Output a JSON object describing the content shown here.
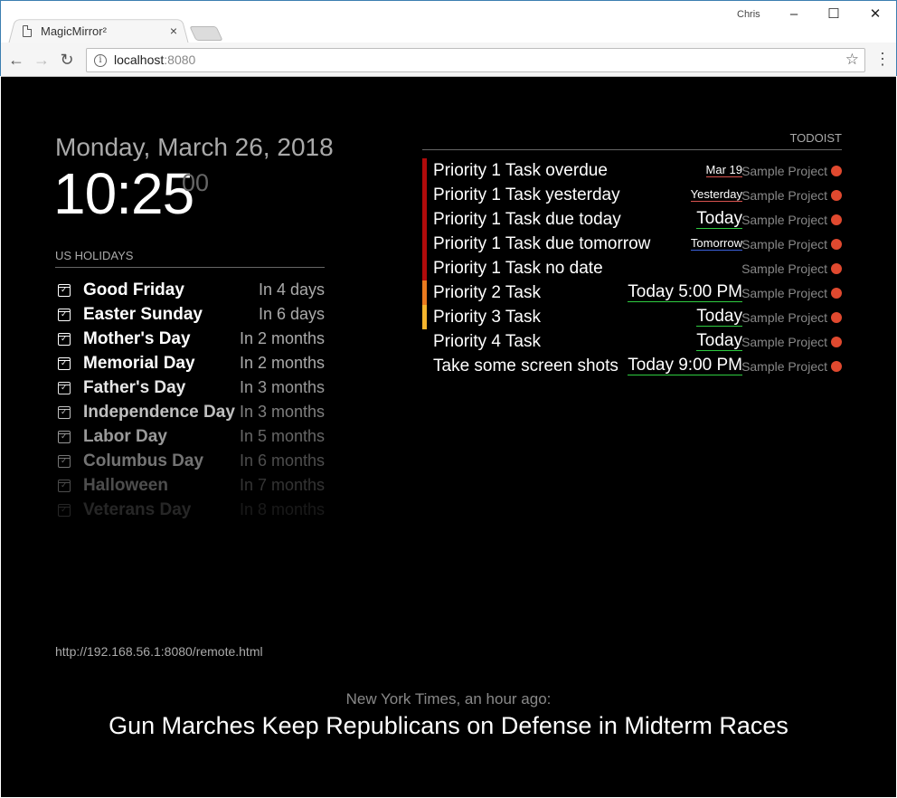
{
  "browser": {
    "tab_title": "MagicMirror²",
    "tab_close": "×",
    "user": "Chris",
    "minimize": "–",
    "maximize": "☐",
    "close": "✕",
    "back": "←",
    "forward": "→",
    "reload": "↻",
    "url_host": "localhost",
    "url_port": ":8080",
    "info": "i",
    "star": "☆",
    "menu": "⋮"
  },
  "clock": {
    "date": "Monday, March 26, 2018",
    "time": "10:25",
    "seconds": "00"
  },
  "holidays": {
    "header": "US HOLIDAYS",
    "items": [
      {
        "name": "Good Friday",
        "when": "In 4 days",
        "opacity": 1.0
      },
      {
        "name": "Easter Sunday",
        "when": "In 6 days",
        "opacity": 1.0
      },
      {
        "name": "Mother's Day",
        "when": "In 2 months",
        "opacity": 1.0
      },
      {
        "name": "Memorial Day",
        "when": "In 2 months",
        "opacity": 1.0
      },
      {
        "name": "Father's Day",
        "when": "In 3 months",
        "opacity": 0.9
      },
      {
        "name": "Independence Day",
        "when": "In 3 months",
        "opacity": 0.75
      },
      {
        "name": "Labor Day",
        "when": "In 5 months",
        "opacity": 0.6
      },
      {
        "name": "Columbus Day",
        "when": "In 6 months",
        "opacity": 0.45
      },
      {
        "name": "Halloween",
        "when": "In 7 months",
        "opacity": 0.3
      },
      {
        "name": "Veterans Day",
        "when": "In 8 months",
        "opacity": 0.15
      }
    ]
  },
  "todoist": {
    "header": "TODOIST",
    "project_color": "#e0492f",
    "tasks": [
      {
        "text": "Priority 1 Task overdue",
        "due": "Mar 19",
        "due_size": "small",
        "underline": "#d9534f",
        "priority_color": "#b00b0b",
        "project": "Sample Project"
      },
      {
        "text": "Priority 1 Task yesterday",
        "due": "Yesterday",
        "due_size": "small",
        "underline": "#d9534f",
        "priority_color": "#b00b0b",
        "project": "Sample Project"
      },
      {
        "text": "Priority 1 Task due today",
        "due": "Today",
        "due_size": "big",
        "underline": "#2ecc40",
        "priority_color": "#b00b0b",
        "project": "Sample Project"
      },
      {
        "text": "Priority 1 Task due tomorrow",
        "due": "Tomorrow",
        "due_size": "small",
        "underline": "#3b5fd9",
        "priority_color": "#b00b0b",
        "project": "Sample Project"
      },
      {
        "text": "Priority 1 Task no date",
        "due": "",
        "due_size": "small",
        "underline": "",
        "priority_color": "#b00b0b",
        "project": "Sample Project"
      },
      {
        "text": "Priority 2 Task",
        "due": "Today 5:00 PM",
        "due_size": "big",
        "underline": "#2ecc40",
        "priority_color": "#ea7a1e",
        "project": "Sample Project"
      },
      {
        "text": "Priority 3 Task",
        "due": "Today",
        "due_size": "big",
        "underline": "#2ecc40",
        "priority_color": "#f5b52d",
        "project": "Sample Project"
      },
      {
        "text": "Priority 4 Task",
        "due": "Today",
        "due_size": "big",
        "underline": "#2ecc40",
        "priority_color": "",
        "project": "Sample Project"
      },
      {
        "text": "Take some screen shots",
        "due": "Today 9:00 PM",
        "due_size": "big",
        "underline": "#2ecc40",
        "priority_color": "",
        "project": "Sample Project"
      }
    ]
  },
  "remote_url": "http://192.168.56.1:8080/remote.html",
  "news": {
    "source": "New York Times, an hour ago:",
    "headline": "Gun Marches Keep Republicans on Defense in Midterm Races"
  }
}
